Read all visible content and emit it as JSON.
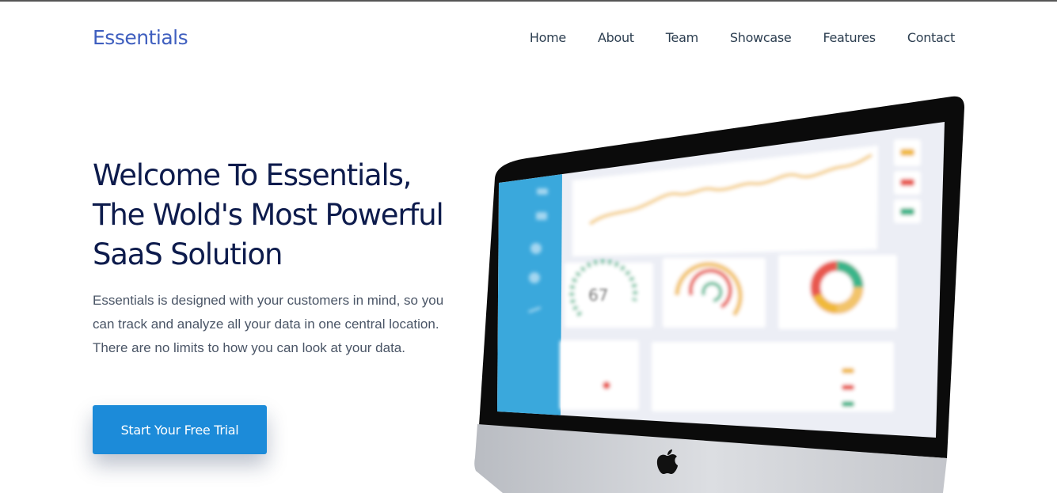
{
  "header": {
    "logo": "Essentials",
    "nav": [
      {
        "label": "Home"
      },
      {
        "label": "About"
      },
      {
        "label": "Team"
      },
      {
        "label": "Showcase"
      },
      {
        "label": "Features"
      },
      {
        "label": "Contact"
      }
    ]
  },
  "hero": {
    "title_lines": [
      "Welcome To Essentials,",
      "The Wold's Most Powerful",
      "SaaS Solution"
    ],
    "description": "Essentials is designed with your customers in mind, so you can track and analyze all your data in one central location. There are no limits to how you can look at your data.",
    "cta_label": "Start Your Free Trial",
    "dashboard_gauge_value": "67"
  },
  "colors": {
    "brand": "#3f5fbf",
    "heading": "#0d1b4c",
    "cta": "#1c8bd9",
    "dashboard_sidebar": "#3aa8dc"
  }
}
